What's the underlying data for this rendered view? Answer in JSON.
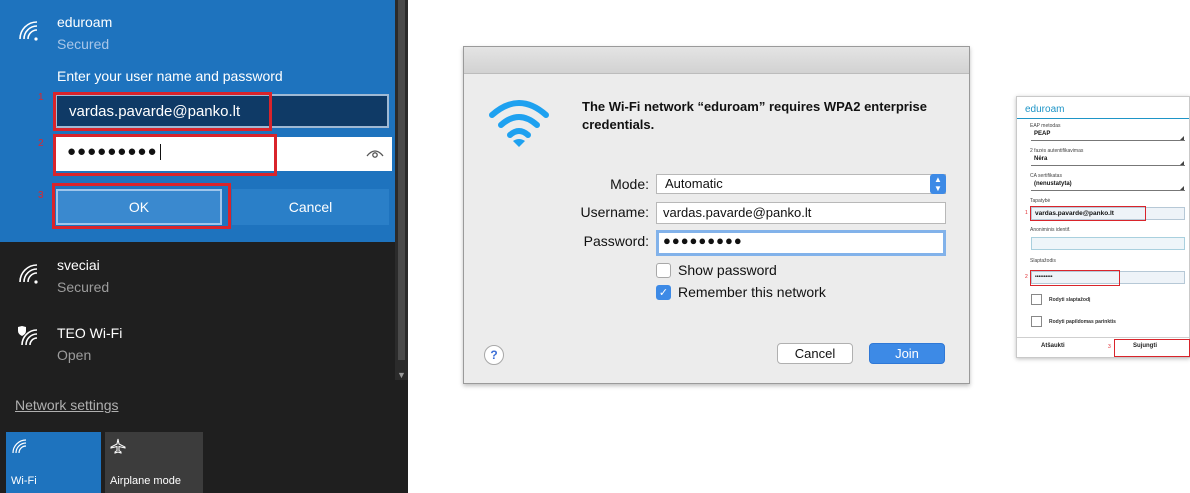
{
  "windows": {
    "networks": [
      {
        "name": "eduroam",
        "status": "Secured"
      },
      {
        "name": "sveciai",
        "status": "Secured"
      },
      {
        "name": "TEO Wi-Fi",
        "status": "Open"
      }
    ],
    "prompt": "Enter your user name and password",
    "username_value": "vardas.pavarde@panko.lt",
    "password_dots": "●●●●●●●●●",
    "ok_label": "OK",
    "cancel_label": "Cancel",
    "network_settings": "Network settings",
    "tiles": [
      {
        "label": "Wi-Fi",
        "icon": "wifi-icon"
      },
      {
        "label": "Airplane mode",
        "icon": "airplane-icon"
      }
    ],
    "step_numbers": [
      "1",
      "2",
      "3"
    ],
    "colors": {
      "accent": "#1e73be",
      "highlight": "#d9242b",
      "background": "#1f1f1f"
    }
  },
  "mac": {
    "heading": "The Wi-Fi network “eduroam” requires WPA2 enterprise credentials.",
    "mode_label": "Mode:",
    "mode_value": "Automatic",
    "username_label": "Username:",
    "username_value": "vardas.pavarde@panko.lt",
    "password_label": "Password:",
    "password_dots": "●●●●●●●●●",
    "show_password": "Show password",
    "show_password_checked": false,
    "remember_network": "Remember this network",
    "remember_network_checked": true,
    "help": "?",
    "cancel_label": "Cancel",
    "join_label": "Join",
    "colors": {
      "accent": "#3d8ae6"
    }
  },
  "android": {
    "title": "eduroam",
    "eap_label": "EAP metodas",
    "eap_value": "PEAP",
    "phase2_label": "2 fazės autentifikavimas",
    "phase2_value": "Nėra",
    "ca_label": "CA sertifikatas",
    "ca_value": "(nenustatyta)",
    "identity_label": "Tapatybė",
    "identity_value": "vardas.pavarde@panko.lt",
    "anon_label": "Anoniminis identif.",
    "password_label": "Slaptažodis",
    "password_dots": "••••••••••",
    "show_password": "Rodyti slaptažodį",
    "advanced": "Rodyti papildomas parinktis",
    "cancel_label": "Atšaukti",
    "connect_label": "Sujungti",
    "step_numbers": [
      "1",
      "2",
      "3"
    ],
    "colors": {
      "accent": "#1e95c7"
    }
  }
}
